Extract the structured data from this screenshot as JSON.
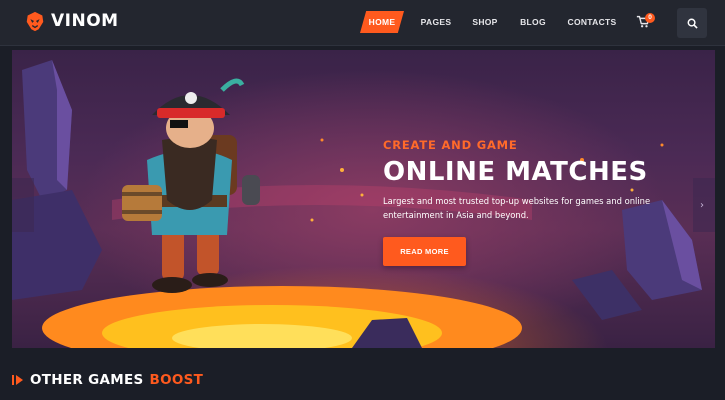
{
  "brand": {
    "name": "VINOM",
    "accent_color": "#ff5a1e"
  },
  "nav": {
    "items": [
      {
        "label": "HOME",
        "active": true
      },
      {
        "label": "PAGES",
        "active": false
      },
      {
        "label": "SHOP",
        "active": false
      },
      {
        "label": "BLOG",
        "active": false
      },
      {
        "label": "CONTACTS",
        "active": false
      }
    ],
    "cart_icon": "cart-icon",
    "cart_count": "0",
    "search_icon": "search-icon"
  },
  "hero": {
    "kicker": "CREATE AND GAME",
    "headline": "ONLINE MATCHES",
    "description": "Largest and most trusted top-up websites for games and online entertainment in Asia and beyond.",
    "cta_label": "READ MORE",
    "next_icon": "chevron-right-icon"
  },
  "section": {
    "title_prefix": "OTHER GAMES",
    "title_accent": "BOOST",
    "marker_icon": "play-marker-icon"
  }
}
